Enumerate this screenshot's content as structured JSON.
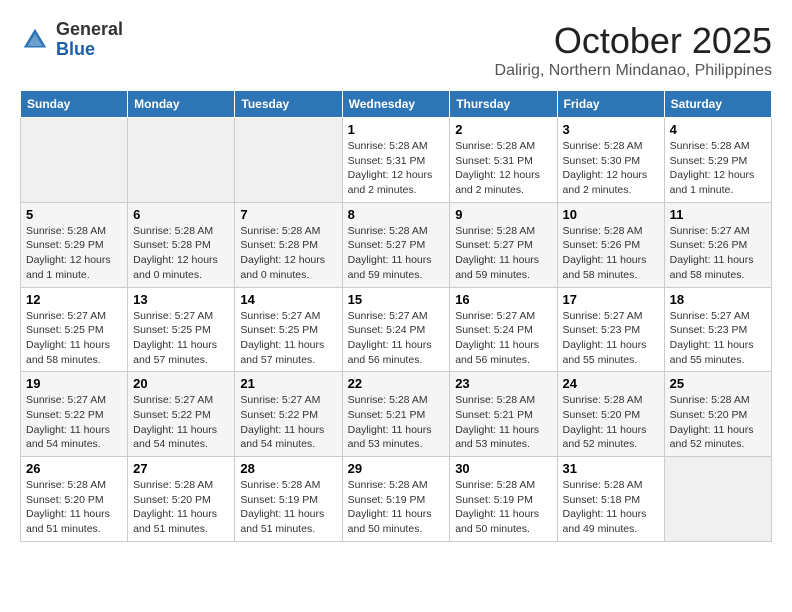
{
  "logo": {
    "general": "General",
    "blue": "Blue"
  },
  "title": "October 2025",
  "location": "Dalirig, Northern Mindanao, Philippines",
  "days_header": [
    "Sunday",
    "Monday",
    "Tuesday",
    "Wednesday",
    "Thursday",
    "Friday",
    "Saturday"
  ],
  "weeks": [
    [
      {
        "num": "",
        "info": ""
      },
      {
        "num": "",
        "info": ""
      },
      {
        "num": "",
        "info": ""
      },
      {
        "num": "1",
        "info": "Sunrise: 5:28 AM\nSunset: 5:31 PM\nDaylight: 12 hours\nand 2 minutes."
      },
      {
        "num": "2",
        "info": "Sunrise: 5:28 AM\nSunset: 5:31 PM\nDaylight: 12 hours\nand 2 minutes."
      },
      {
        "num": "3",
        "info": "Sunrise: 5:28 AM\nSunset: 5:30 PM\nDaylight: 12 hours\nand 2 minutes."
      },
      {
        "num": "4",
        "info": "Sunrise: 5:28 AM\nSunset: 5:29 PM\nDaylight: 12 hours\nand 1 minute."
      }
    ],
    [
      {
        "num": "5",
        "info": "Sunrise: 5:28 AM\nSunset: 5:29 PM\nDaylight: 12 hours\nand 1 minute."
      },
      {
        "num": "6",
        "info": "Sunrise: 5:28 AM\nSunset: 5:28 PM\nDaylight: 12 hours\nand 0 minutes."
      },
      {
        "num": "7",
        "info": "Sunrise: 5:28 AM\nSunset: 5:28 PM\nDaylight: 12 hours\nand 0 minutes."
      },
      {
        "num": "8",
        "info": "Sunrise: 5:28 AM\nSunset: 5:27 PM\nDaylight: 11 hours\nand 59 minutes."
      },
      {
        "num": "9",
        "info": "Sunrise: 5:28 AM\nSunset: 5:27 PM\nDaylight: 11 hours\nand 59 minutes."
      },
      {
        "num": "10",
        "info": "Sunrise: 5:28 AM\nSunset: 5:26 PM\nDaylight: 11 hours\nand 58 minutes."
      },
      {
        "num": "11",
        "info": "Sunrise: 5:27 AM\nSunset: 5:26 PM\nDaylight: 11 hours\nand 58 minutes."
      }
    ],
    [
      {
        "num": "12",
        "info": "Sunrise: 5:27 AM\nSunset: 5:25 PM\nDaylight: 11 hours\nand 58 minutes."
      },
      {
        "num": "13",
        "info": "Sunrise: 5:27 AM\nSunset: 5:25 PM\nDaylight: 11 hours\nand 57 minutes."
      },
      {
        "num": "14",
        "info": "Sunrise: 5:27 AM\nSunset: 5:25 PM\nDaylight: 11 hours\nand 57 minutes."
      },
      {
        "num": "15",
        "info": "Sunrise: 5:27 AM\nSunset: 5:24 PM\nDaylight: 11 hours\nand 56 minutes."
      },
      {
        "num": "16",
        "info": "Sunrise: 5:27 AM\nSunset: 5:24 PM\nDaylight: 11 hours\nand 56 minutes."
      },
      {
        "num": "17",
        "info": "Sunrise: 5:27 AM\nSunset: 5:23 PM\nDaylight: 11 hours\nand 55 minutes."
      },
      {
        "num": "18",
        "info": "Sunrise: 5:27 AM\nSunset: 5:23 PM\nDaylight: 11 hours\nand 55 minutes."
      }
    ],
    [
      {
        "num": "19",
        "info": "Sunrise: 5:27 AM\nSunset: 5:22 PM\nDaylight: 11 hours\nand 54 minutes."
      },
      {
        "num": "20",
        "info": "Sunrise: 5:27 AM\nSunset: 5:22 PM\nDaylight: 11 hours\nand 54 minutes."
      },
      {
        "num": "21",
        "info": "Sunrise: 5:27 AM\nSunset: 5:22 PM\nDaylight: 11 hours\nand 54 minutes."
      },
      {
        "num": "22",
        "info": "Sunrise: 5:28 AM\nSunset: 5:21 PM\nDaylight: 11 hours\nand 53 minutes."
      },
      {
        "num": "23",
        "info": "Sunrise: 5:28 AM\nSunset: 5:21 PM\nDaylight: 11 hours\nand 53 minutes."
      },
      {
        "num": "24",
        "info": "Sunrise: 5:28 AM\nSunset: 5:20 PM\nDaylight: 11 hours\nand 52 minutes."
      },
      {
        "num": "25",
        "info": "Sunrise: 5:28 AM\nSunset: 5:20 PM\nDaylight: 11 hours\nand 52 minutes."
      }
    ],
    [
      {
        "num": "26",
        "info": "Sunrise: 5:28 AM\nSunset: 5:20 PM\nDaylight: 11 hours\nand 51 minutes."
      },
      {
        "num": "27",
        "info": "Sunrise: 5:28 AM\nSunset: 5:20 PM\nDaylight: 11 hours\nand 51 minutes."
      },
      {
        "num": "28",
        "info": "Sunrise: 5:28 AM\nSunset: 5:19 PM\nDaylight: 11 hours\nand 51 minutes."
      },
      {
        "num": "29",
        "info": "Sunrise: 5:28 AM\nSunset: 5:19 PM\nDaylight: 11 hours\nand 50 minutes."
      },
      {
        "num": "30",
        "info": "Sunrise: 5:28 AM\nSunset: 5:19 PM\nDaylight: 11 hours\nand 50 minutes."
      },
      {
        "num": "31",
        "info": "Sunrise: 5:28 AM\nSunset: 5:18 PM\nDaylight: 11 hours\nand 49 minutes."
      },
      {
        "num": "",
        "info": ""
      }
    ]
  ]
}
